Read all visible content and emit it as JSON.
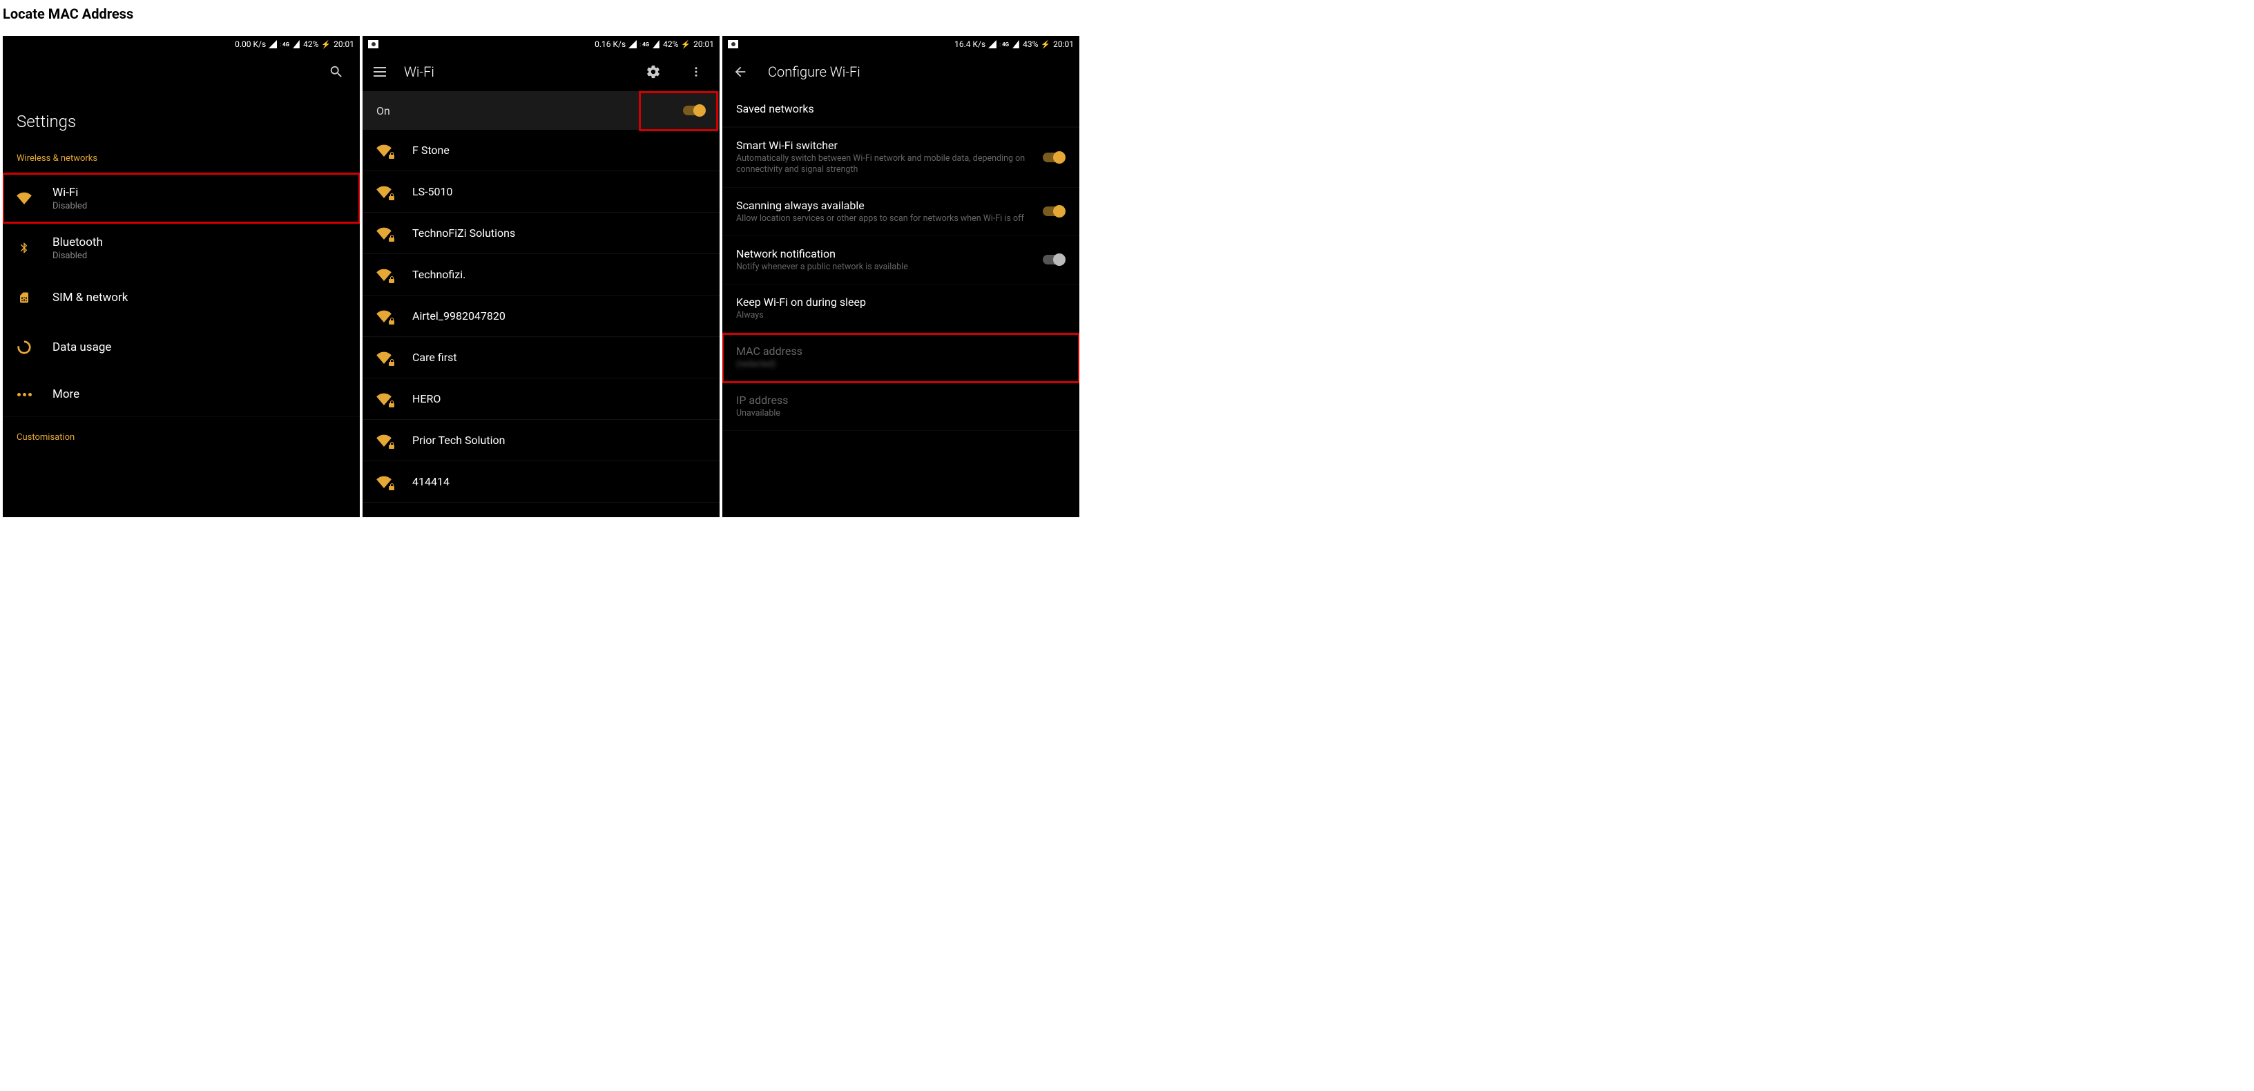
{
  "page_heading": "Locate MAC Address",
  "colors": {
    "accent": "#e6a835",
    "highlight": "#d10000"
  },
  "screen1": {
    "status": {
      "speed": "0.00 K/s",
      "net_badge": "4G",
      "battery": "42%",
      "time": "20:01"
    },
    "title": "Settings",
    "sections": [
      {
        "header": "Wireless & networks",
        "items": [
          {
            "icon": "wifi",
            "label": "Wi-Fi",
            "sub": "Disabled",
            "highlighted": true
          },
          {
            "icon": "bluetooth",
            "label": "Bluetooth",
            "sub": "Disabled"
          },
          {
            "icon": "sim",
            "label": "SIM & network",
            "sub": ""
          },
          {
            "icon": "data",
            "label": "Data usage",
            "sub": ""
          },
          {
            "icon": "more",
            "label": "More",
            "sub": ""
          }
        ]
      },
      {
        "header": "Customisation",
        "items": []
      }
    ]
  },
  "screen2": {
    "status": {
      "speed": "0.16 K/s",
      "net_badge": "4G",
      "battery": "42%",
      "time": "20:01"
    },
    "title": "Wi-Fi",
    "toggle_label": "On",
    "toggle_on": true,
    "networks": [
      {
        "name": "F Stone",
        "locked": true
      },
      {
        "name": "LS-5010",
        "locked": true
      },
      {
        "name": "TechnoFiZi Solutions",
        "locked": true
      },
      {
        "name": "Technofizi.",
        "locked": true
      },
      {
        "name": "Airtel_9982047820",
        "locked": true
      },
      {
        "name": "Care first",
        "locked": true
      },
      {
        "name": "HERO",
        "locked": true
      },
      {
        "name": "Prior Tech Solution",
        "locked": true
      },
      {
        "name": "414414",
        "locked": true
      }
    ]
  },
  "screen3": {
    "status": {
      "speed": "16.4 K/s",
      "net_badge": "4G",
      "battery": "43%",
      "time": "20:01"
    },
    "title": "Configure Wi-Fi",
    "items": [
      {
        "label": "Saved networks",
        "sub": "",
        "type": "link"
      },
      {
        "label": "Smart Wi-Fi switcher",
        "sub": "Automatically switch between Wi-Fi network and mobile data, depending on connectivity and signal strength",
        "toggle": "on"
      },
      {
        "label": "Scanning always available",
        "sub": "Allow location services or other apps to scan for networks when Wi-Fi is off",
        "toggle": "on"
      },
      {
        "label": "Network notification",
        "sub": "Notify whenever a public network is available",
        "toggle": "off"
      },
      {
        "label": "Keep Wi-Fi on during sleep",
        "sub": "Always",
        "type": "link"
      },
      {
        "label": "MAC address",
        "sub": "(redacted)",
        "type": "info",
        "dim": true,
        "blur_sub": true,
        "highlighted": true
      },
      {
        "label": "IP address",
        "sub": "Unavailable",
        "type": "info",
        "dim": true
      }
    ]
  }
}
